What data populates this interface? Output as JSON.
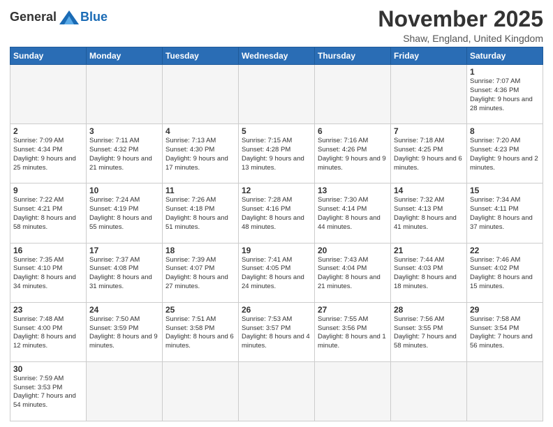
{
  "header": {
    "logo_general": "General",
    "logo_blue": "Blue",
    "title": "November 2025",
    "subtitle": "Shaw, England, United Kingdom"
  },
  "days_of_week": [
    "Sunday",
    "Monday",
    "Tuesday",
    "Wednesday",
    "Thursday",
    "Friday",
    "Saturday"
  ],
  "weeks": [
    [
      {
        "day": "",
        "info": "",
        "empty": true
      },
      {
        "day": "",
        "info": "",
        "empty": true
      },
      {
        "day": "",
        "info": "",
        "empty": true
      },
      {
        "day": "",
        "info": "",
        "empty": true
      },
      {
        "day": "",
        "info": "",
        "empty": true
      },
      {
        "day": "",
        "info": "",
        "empty": true
      },
      {
        "day": "1",
        "info": "Sunrise: 7:07 AM\nSunset: 4:36 PM\nDaylight: 9 hours\nand 28 minutes."
      }
    ],
    [
      {
        "day": "2",
        "info": "Sunrise: 7:09 AM\nSunset: 4:34 PM\nDaylight: 9 hours\nand 25 minutes."
      },
      {
        "day": "3",
        "info": "Sunrise: 7:11 AM\nSunset: 4:32 PM\nDaylight: 9 hours\nand 21 minutes."
      },
      {
        "day": "4",
        "info": "Sunrise: 7:13 AM\nSunset: 4:30 PM\nDaylight: 9 hours\nand 17 minutes."
      },
      {
        "day": "5",
        "info": "Sunrise: 7:15 AM\nSunset: 4:28 PM\nDaylight: 9 hours\nand 13 minutes."
      },
      {
        "day": "6",
        "info": "Sunrise: 7:16 AM\nSunset: 4:26 PM\nDaylight: 9 hours\nand 9 minutes."
      },
      {
        "day": "7",
        "info": "Sunrise: 7:18 AM\nSunset: 4:25 PM\nDaylight: 9 hours\nand 6 minutes."
      },
      {
        "day": "8",
        "info": "Sunrise: 7:20 AM\nSunset: 4:23 PM\nDaylight: 9 hours\nand 2 minutes."
      }
    ],
    [
      {
        "day": "9",
        "info": "Sunrise: 7:22 AM\nSunset: 4:21 PM\nDaylight: 8 hours\nand 58 minutes."
      },
      {
        "day": "10",
        "info": "Sunrise: 7:24 AM\nSunset: 4:19 PM\nDaylight: 8 hours\nand 55 minutes."
      },
      {
        "day": "11",
        "info": "Sunrise: 7:26 AM\nSunset: 4:18 PM\nDaylight: 8 hours\nand 51 minutes."
      },
      {
        "day": "12",
        "info": "Sunrise: 7:28 AM\nSunset: 4:16 PM\nDaylight: 8 hours\nand 48 minutes."
      },
      {
        "day": "13",
        "info": "Sunrise: 7:30 AM\nSunset: 4:14 PM\nDaylight: 8 hours\nand 44 minutes."
      },
      {
        "day": "14",
        "info": "Sunrise: 7:32 AM\nSunset: 4:13 PM\nDaylight: 8 hours\nand 41 minutes."
      },
      {
        "day": "15",
        "info": "Sunrise: 7:34 AM\nSunset: 4:11 PM\nDaylight: 8 hours\nand 37 minutes."
      }
    ],
    [
      {
        "day": "16",
        "info": "Sunrise: 7:35 AM\nSunset: 4:10 PM\nDaylight: 8 hours\nand 34 minutes."
      },
      {
        "day": "17",
        "info": "Sunrise: 7:37 AM\nSunset: 4:08 PM\nDaylight: 8 hours\nand 31 minutes."
      },
      {
        "day": "18",
        "info": "Sunrise: 7:39 AM\nSunset: 4:07 PM\nDaylight: 8 hours\nand 27 minutes."
      },
      {
        "day": "19",
        "info": "Sunrise: 7:41 AM\nSunset: 4:05 PM\nDaylight: 8 hours\nand 24 minutes."
      },
      {
        "day": "20",
        "info": "Sunrise: 7:43 AM\nSunset: 4:04 PM\nDaylight: 8 hours\nand 21 minutes."
      },
      {
        "day": "21",
        "info": "Sunrise: 7:44 AM\nSunset: 4:03 PM\nDaylight: 8 hours\nand 18 minutes."
      },
      {
        "day": "22",
        "info": "Sunrise: 7:46 AM\nSunset: 4:02 PM\nDaylight: 8 hours\nand 15 minutes."
      }
    ],
    [
      {
        "day": "23",
        "info": "Sunrise: 7:48 AM\nSunset: 4:00 PM\nDaylight: 8 hours\nand 12 minutes."
      },
      {
        "day": "24",
        "info": "Sunrise: 7:50 AM\nSunset: 3:59 PM\nDaylight: 8 hours\nand 9 minutes."
      },
      {
        "day": "25",
        "info": "Sunrise: 7:51 AM\nSunset: 3:58 PM\nDaylight: 8 hours\nand 6 minutes."
      },
      {
        "day": "26",
        "info": "Sunrise: 7:53 AM\nSunset: 3:57 PM\nDaylight: 8 hours\nand 4 minutes."
      },
      {
        "day": "27",
        "info": "Sunrise: 7:55 AM\nSunset: 3:56 PM\nDaylight: 8 hours\nand 1 minute."
      },
      {
        "day": "28",
        "info": "Sunrise: 7:56 AM\nSunset: 3:55 PM\nDaylight: 7 hours\nand 58 minutes."
      },
      {
        "day": "29",
        "info": "Sunrise: 7:58 AM\nSunset: 3:54 PM\nDaylight: 7 hours\nand 56 minutes."
      }
    ],
    [
      {
        "day": "30",
        "info": "Sunrise: 7:59 AM\nSunset: 3:53 PM\nDaylight: 7 hours\nand 54 minutes."
      },
      {
        "day": "",
        "info": "",
        "empty": true
      },
      {
        "day": "",
        "info": "",
        "empty": true
      },
      {
        "day": "",
        "info": "",
        "empty": true
      },
      {
        "day": "",
        "info": "",
        "empty": true
      },
      {
        "day": "",
        "info": "",
        "empty": true
      },
      {
        "day": "",
        "info": "",
        "empty": true
      }
    ]
  ]
}
